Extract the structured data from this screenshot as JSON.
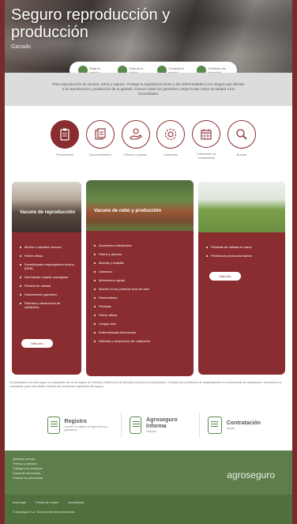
{
  "hero": {
    "title": "Seguro reproducción y producción",
    "subtitle": "Ganado"
  },
  "steps": [
    {
      "label": "Elige tu seguro",
      "icon": "check-icon"
    },
    {
      "label": "Calcula tu póliza",
      "icon": "calculator-icon"
    },
    {
      "label": "Contrata tu seguro",
      "icon": "signature-icon"
    },
    {
      "label": "Gestiona tus siniestros",
      "icon": "document-icon"
    }
  ],
  "intro": {
    "text": "Para reproducción de vacuno, ovino y caprino. Protege tu explotación frente a las enfermedades y los riesgos que afectan a la reproducción y producción de tu ganado. Conoce todas las garantías y elige la que mejor se adapta a tus necesidades."
  },
  "categories": [
    {
      "label": "Productores",
      "icon": "clipboard-icon",
      "active": true
    },
    {
      "label": "Documentación",
      "icon": "documents-icon",
      "active": false
    },
    {
      "label": "Precios y plazos",
      "icon": "hand-coin-icon",
      "active": false
    },
    {
      "label": "Garantías",
      "icon": "gear-icon",
      "active": false
    },
    {
      "label": "Calendario de contratación",
      "icon": "calendar-icon",
      "active": false
    },
    {
      "label": "Buscar",
      "icon": "search-icon",
      "active": false
    }
  ],
  "cards": [
    {
      "title": "Vacuno de reproducción",
      "items": [
        "Muerte o sacrificio forzoso",
        "Fiebre aftosa",
        "Encefalopatía espongiforme bovina (EEB)",
        "Dermatosis nodular contagiosa",
        "Pérdida de calidad",
        "Saneamiento ganadero",
        "Retirada y destrucción de cadáveres"
      ],
      "button": "Más info"
    },
    {
      "title": "Vacuno de cebo y producción",
      "items": [
        "Accidentes individuales",
        "Partos y abortos",
        "Mamitis y mastitis",
        "Carbunco",
        "Meteorismo agudo",
        "Muerte en los primeros días de vida",
        "Saneamiento",
        "Pérdidas",
        "Fiebre aftosa",
        "Lengua azul",
        "Enfermedades infecciosas",
        "Retirada y destrucción de cadáveres"
      ],
      "button": ""
    },
    {
      "title": "",
      "items": [
        "Pérdidas de calidad en carne",
        "Pérdida de producción láctea"
      ],
      "button": "Más info"
    }
  ],
  "footnote": "La contratación de este seguro es compatible con la del seguro de retirada y destrucción de animales muertos en la explotación. Consulta las condiciones de aseguramiento en el documento de contratación. Información no contractual; para más detalle consulte las condiciones especiales del seguro.",
  "services": [
    {
      "name": "Registro",
      "desc": "Accede al registro de agricultores y ganaderos",
      "icon": "form-icon"
    },
    {
      "name": "Agroseguro Informa",
      "desc": "Noticias",
      "icon": "newsletter-icon"
    },
    {
      "name": "Contratación",
      "desc": "Ayuda",
      "icon": "contract-icon"
    }
  ],
  "footer": {
    "links": [
      "Quiénes somos",
      "Prensa y noticias",
      "Trabaja con nosotros",
      "Canal de denuncias",
      "Política de privacidad"
    ],
    "brand": "agroseguro",
    "legal": [
      "Aviso legal",
      "Política de cookies",
      "Accesibilidad"
    ],
    "copyright": "© Agroseguro S.A. Todos los derechos reservados."
  },
  "colors": {
    "brand_red": "#8a2d30",
    "brand_green": "#5d7d4a",
    "outer_bg": "#7a2a2c"
  }
}
